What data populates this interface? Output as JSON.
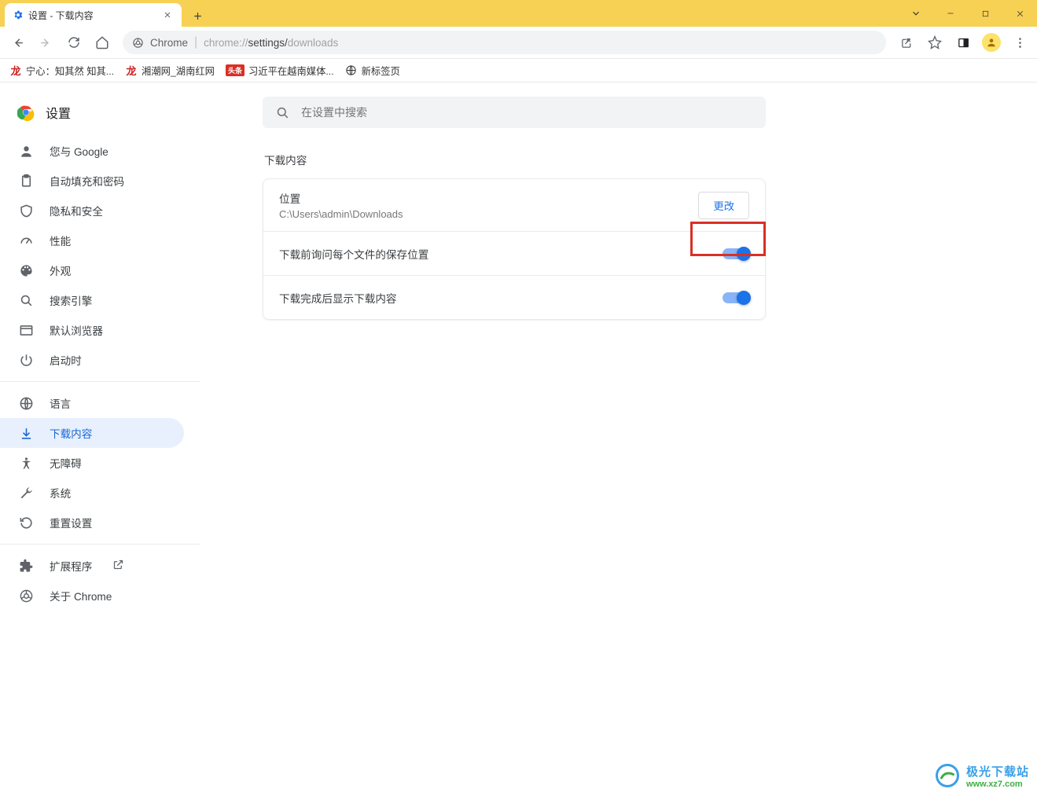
{
  "tab": {
    "title": "设置 - 下载内容"
  },
  "omnibox": {
    "label": "Chrome",
    "url_prefix": "chrome://",
    "url_mid": "settings/",
    "url_end": "downloads"
  },
  "bookmarks": [
    {
      "label": "宁心：知其然 知其..."
    },
    {
      "label": "湘潮网_湖南红网"
    },
    {
      "label": "习近平在越南媒体..."
    },
    {
      "label": "新标签页"
    }
  ],
  "app_title": "设置",
  "search_placeholder": "在设置中搜索",
  "sidebar": {
    "items": [
      {
        "label": "您与 Google"
      },
      {
        "label": "自动填充和密码"
      },
      {
        "label": "隐私和安全"
      },
      {
        "label": "性能"
      },
      {
        "label": "外观"
      },
      {
        "label": "搜索引擎"
      },
      {
        "label": "默认浏览器"
      },
      {
        "label": "启动时"
      }
    ],
    "items2": [
      {
        "label": "语言"
      },
      {
        "label": "下载内容"
      },
      {
        "label": "无障碍"
      },
      {
        "label": "系统"
      },
      {
        "label": "重置设置"
      }
    ],
    "ext_label": "扩展程序",
    "about_label": "关于 Chrome"
  },
  "section": {
    "title": "下载内容",
    "location_label": "位置",
    "location_path": "C:\\Users\\admin\\Downloads",
    "change_btn": "更改",
    "ask_label": "下载前询问每个文件的保存位置",
    "show_label": "下载完成后显示下载内容"
  },
  "watermark": {
    "line1": "极光下载站",
    "line2": "www.xz7.com"
  }
}
